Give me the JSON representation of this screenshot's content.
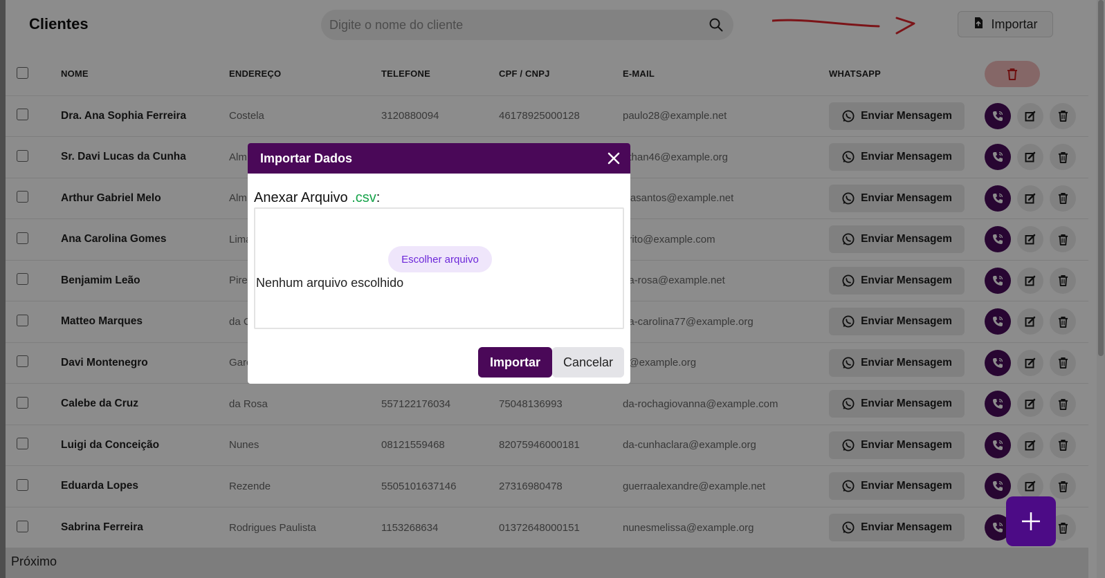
{
  "page": {
    "title": "Clientes"
  },
  "search": {
    "placeholder": "Digite o nome do cliente"
  },
  "toolbar": {
    "import_label": "Importar"
  },
  "table": {
    "headers": [
      "NOME",
      "ENDEREÇO",
      "TELEFONE",
      "CPF / CNPJ",
      "E-MAIL",
      "WHATSAPP"
    ],
    "send_label": "Enviar Mensagem",
    "rows": [
      {
        "name": "Dra. Ana Sophia Ferreira",
        "address": "Costela",
        "phone": "3120880094",
        "doc": "46178925000128",
        "email": "paulo28@example.net"
      },
      {
        "name": "Sr. Davi Lucas da Cunha",
        "address": "Alm",
        "phone": "",
        "doc": "",
        "email": "athan46@example.org"
      },
      {
        "name": "Arthur Gabriel Melo",
        "address": "Alm",
        "phone": "",
        "doc": "",
        "email": "isasantos@example.net"
      },
      {
        "name": "Ana Carolina Gomes",
        "address": "Lima",
        "phone": "",
        "doc": "",
        "email": "orito@example.com"
      },
      {
        "name": "Benjamim Leão",
        "address": "Pires",
        "phone": "",
        "doc": "",
        "email": "da-rosa@example.net"
      },
      {
        "name": "Matteo Marques",
        "address": "da C",
        "phone": "",
        "doc": "",
        "email": "na-carolina77@example.org"
      },
      {
        "name": "Davi Montenegro",
        "address": "Garc",
        "phone": "",
        "doc": "",
        "email": "a@example.org"
      },
      {
        "name": "Calebe da Cruz",
        "address": "da Rosa",
        "phone": "557122176034",
        "doc": "75048136993",
        "email": "da-rochagiovanna@example.com"
      },
      {
        "name": "Luigi da Conceição",
        "address": "Nunes",
        "phone": "08121559468",
        "doc": "82075946000181",
        "email": "da-cunhaclara@example.org"
      },
      {
        "name": "Eduarda Lopes",
        "address": "Rezende",
        "phone": "5505101637146",
        "doc": "27316980478",
        "email": "guerraalexandre@example.net"
      },
      {
        "name": "Sabrina Ferreira",
        "address": "Rodrigues Paulista",
        "phone": "1153268634",
        "doc": "01372648000151",
        "email": "nunesmelissa@example.org"
      }
    ]
  },
  "footer": {
    "next_label": "Próximo"
  },
  "modal": {
    "title": "Importar Dados",
    "attach_label": "Anexar Arquivo ",
    "attach_ext": ".csv",
    "attach_suffix": ":",
    "choose_label": "Escolher arquivo",
    "no_file_label": "Nenhum arquivo escolhido",
    "import_label": "Importar",
    "cancel_label": "Cancelar"
  },
  "icons": {
    "search": "search-icon",
    "import": "upload-file-icon",
    "delete": "trash-icon",
    "whatsapp": "whatsapp-icon",
    "call": "phone-call-icon",
    "edit": "edit-icon",
    "close": "close-icon",
    "add": "plus-icon"
  },
  "colors": {
    "primary": "#4a0858",
    "fab": "#4c0b86",
    "csv_green": "#16a34a",
    "danger_bg": "#f3bcbc",
    "annotation": "#e0262d"
  }
}
